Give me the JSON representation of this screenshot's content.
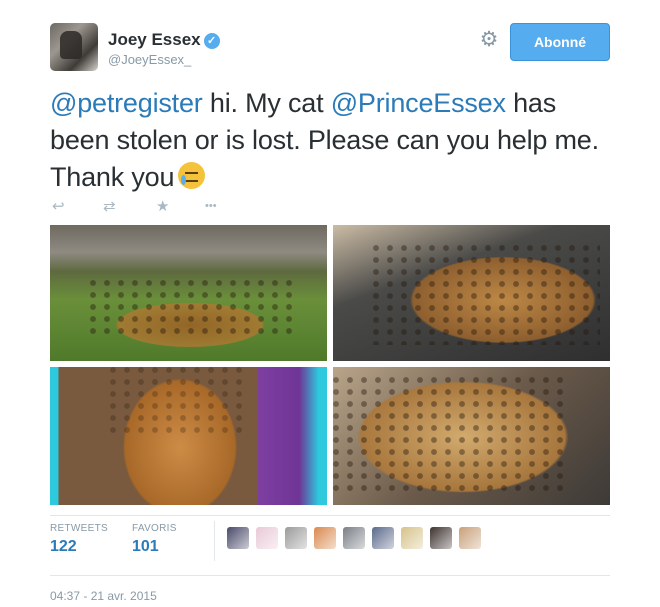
{
  "user": {
    "name": "Joey Essex",
    "handle": "@JoeyEssex_",
    "verified_icon": "✓",
    "follow_label": "Abonné",
    "gear_icon": "⚙"
  },
  "tweet": {
    "mention1": "@petregister",
    "text1": " hi. My cat ",
    "mention2": "@PrinceEssex",
    "text2": " has been stolen or is lost. Please can you help me. Thank you"
  },
  "actions": {
    "reply_icon": "↩",
    "retweet_icon": "⇄",
    "favorite_icon": "★",
    "more_icon": "•••"
  },
  "stats": {
    "retweets_label": "RETWEETS",
    "retweets_value": "122",
    "favorites_label": "FAVORIS",
    "favorites_value": "101"
  },
  "favoriters": [
    {
      "color": "#4a4a6a"
    },
    {
      "color": "#e9c9d6"
    },
    {
      "color": "#9b9b9b"
    },
    {
      "color": "#d98a4f"
    },
    {
      "color": "#7a7f86"
    },
    {
      "color": "#5b6a8c"
    },
    {
      "color": "#d6c28a"
    },
    {
      "color": "#3e3330"
    },
    {
      "color": "#c9a07a"
    }
  ],
  "timestamp": "04:37 - 21 avr. 2015"
}
